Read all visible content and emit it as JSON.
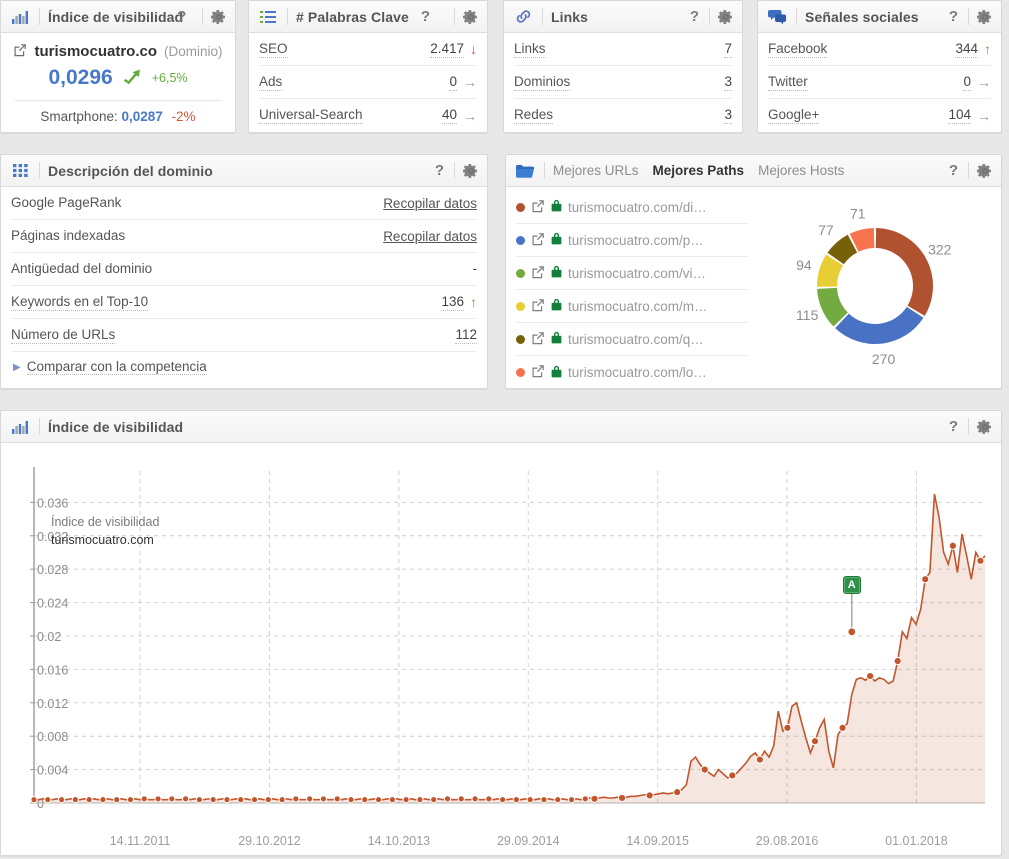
{
  "panels": {
    "visibility_index": {
      "title": "Índice de visibilidad",
      "icon": "bar-chart-icon",
      "help": "?",
      "domain": "turismocuatro.co",
      "domain_tag": "(Dominio)",
      "value": "0,0296",
      "delta": "+6,5%",
      "smartphone_label": "Smartphone:",
      "smartphone_value": "0,0287",
      "smartphone_delta": "-2%"
    },
    "keywords": {
      "title": "# Palabras Clave",
      "icon": "list-icon",
      "help": "?",
      "rows": [
        {
          "label": "SEO",
          "value": "2.417",
          "trend": "down"
        },
        {
          "label": "Ads",
          "value": "0",
          "trend": "right"
        },
        {
          "label": "Universal-Search",
          "value": "40",
          "trend": "right"
        }
      ]
    },
    "links": {
      "title": "Links",
      "icon": "link-icon",
      "help": "?",
      "rows": [
        {
          "label": "Links",
          "value": "7",
          "trend": "none"
        },
        {
          "label": "Dominios",
          "value": "3",
          "trend": "none"
        },
        {
          "label": "Redes",
          "value": "3",
          "trend": "none"
        }
      ]
    },
    "social": {
      "title": "Señales sociales",
      "icon": "speech-bubbles-icon",
      "help": "?",
      "rows": [
        {
          "label": "Facebook",
          "value": "344",
          "trend": "up"
        },
        {
          "label": "Twitter",
          "value": "0",
          "trend": "right"
        },
        {
          "label": "Google+",
          "value": "104",
          "trend": "right"
        }
      ]
    },
    "domain_description": {
      "title": "Descripción del dominio",
      "icon": "grid-icon",
      "help": "?",
      "rows": [
        {
          "label": "Google PageRank",
          "value": "Recopilar datos",
          "type": "link"
        },
        {
          "label": "Páginas indexadas",
          "value": "Recopilar datos",
          "type": "link"
        },
        {
          "label": "Antigüedad del dominio",
          "value": "-",
          "type": "plain"
        },
        {
          "label": "Keywords en el Top-10",
          "value": "136",
          "type": "value",
          "trend": "up"
        },
        {
          "label": "Número de URLs",
          "value": "112",
          "type": "value",
          "trend": "none"
        }
      ],
      "compare_label": "Comparar con la competencia"
    },
    "best_paths": {
      "icon": "folder-icon",
      "help": "?",
      "tabs": [
        {
          "label": "Mejores URLs",
          "active": false
        },
        {
          "label": "Mejores Paths",
          "active": true
        },
        {
          "label": "Mejores Hosts",
          "active": false
        }
      ],
      "items": [
        {
          "url": "turismocuatro.com/di…",
          "color": "#b0522f"
        },
        {
          "url": "turismocuatro.com/p…",
          "color": "#4a72c4"
        },
        {
          "url": "turismocuatro.com/vi…",
          "color": "#73ab41"
        },
        {
          "url": "turismocuatro.com/m…",
          "color": "#e8cd34"
        },
        {
          "url": "turismocuatro.com/q…",
          "color": "#786009"
        },
        {
          "url": "turismocuatro.com/lo…",
          "color": "#f7734f"
        }
      ]
    },
    "visibility_chart": {
      "title": "Índice de visibilidad",
      "icon": "bar-chart-icon",
      "help": "?",
      "series_title": "Índice de visibilidad",
      "series_domain": "turismocuatro.com",
      "annotation": "A"
    }
  },
  "chart_data": [
    {
      "type": "pie",
      "title": "Mejores Paths",
      "labels": [
        "turismocuatro.com/di…",
        "turismocuatro.com/p…",
        "turismocuatro.com/vi…",
        "turismocuatro.com/m…",
        "turismocuatro.com/q…",
        "turismocuatro.com/lo…"
      ],
      "values": [
        322,
        270,
        115,
        94,
        77,
        71
      ],
      "colors": [
        "#b0522f",
        "#4a72c4",
        "#73ab41",
        "#e8cd34",
        "#786009",
        "#f7734f"
      ],
      "donut": true,
      "legend": "left",
      "data_labels": [
        "322",
        "270",
        "115",
        "94",
        "77",
        "71"
      ]
    },
    {
      "type": "area",
      "title": "Índice de visibilidad",
      "series_name": "turismocuatro.com",
      "xlabel": "",
      "ylabel": "Índice de visibilidad",
      "ylim": [
        0,
        0.0376
      ],
      "yticks": [
        "0",
        "0.004",
        "0.008",
        "0.012",
        "0.016",
        "0.02",
        "0.024",
        "0.028",
        "0.032",
        "0.036"
      ],
      "ytick_values": [
        0,
        0.004,
        0.008,
        0.012,
        0.016,
        0.02,
        0.024,
        0.028,
        0.032,
        0.036
      ],
      "xticks": [
        "14.11.2011",
        "29.10.2012",
        "14.10.2013",
        "29.09.2014",
        "14.09.2015",
        "29.08.2016",
        "01.01.2018"
      ],
      "grid": true,
      "line_color": "#c2552c",
      "fill_color": "rgba(200,100,60,0.16)",
      "annotation_marker": {
        "label": "A",
        "x_index": 178,
        "y_value": 0.0205
      },
      "values": [
        0.0004,
        0.0004,
        0.0005,
        0.0004,
        0.0004,
        0.0005,
        0.0004,
        0.0004,
        0.0005,
        0.0004,
        0.0004,
        0.0005,
        0.0004,
        0.0005,
        0.0004,
        0.0004,
        0.0005,
        0.0004,
        0.0004,
        0.0005,
        0.0004,
        0.0004,
        0.0005,
        0.0004,
        0.0005,
        0.0004,
        0.0004,
        0.0005,
        0.0004,
        0.0004,
        0.0005,
        0.0004,
        0.0004,
        0.0005,
        0.0004,
        0.0005,
        0.0004,
        0.0004,
        0.0005,
        0.0004,
        0.0004,
        0.0005,
        0.0004,
        0.0004,
        0.0005,
        0.0004,
        0.0005,
        0.0004,
        0.0004,
        0.0005,
        0.0004,
        0.0004,
        0.0005,
        0.0004,
        0.0004,
        0.0005,
        0.0004,
        0.0005,
        0.0004,
        0.0004,
        0.0005,
        0.0004,
        0.0004,
        0.0005,
        0.0004,
        0.0004,
        0.0005,
        0.0004,
        0.0005,
        0.0004,
        0.0004,
        0.0005,
        0.0004,
        0.0004,
        0.0005,
        0.0004,
        0.0004,
        0.0005,
        0.0004,
        0.0005,
        0.0004,
        0.0004,
        0.0005,
        0.0004,
        0.0004,
        0.0005,
        0.0004,
        0.0004,
        0.0005,
        0.0004,
        0.0005,
        0.0004,
        0.0004,
        0.0005,
        0.0004,
        0.0004,
        0.0005,
        0.0004,
        0.0004,
        0.0005,
        0.0004,
        0.0005,
        0.0004,
        0.0004,
        0.0005,
        0.0004,
        0.0004,
        0.0005,
        0.0004,
        0.0004,
        0.0005,
        0.0004,
        0.0005,
        0.0004,
        0.0004,
        0.0005,
        0.0004,
        0.0004,
        0.0005,
        0.0004,
        0.0005,
        0.0006,
        0.0005,
        0.0006,
        0.0007,
        0.0006,
        0.0006,
        0.0007,
        0.0006,
        0.0007,
        0.0008,
        0.0008,
        0.0009,
        0.001,
        0.0009,
        0.001,
        0.0011,
        0.0012,
        0.0011,
        0.0012,
        0.0013,
        0.0016,
        0.0022,
        0.005,
        0.0055,
        0.0046,
        0.004,
        0.0036,
        0.0032,
        0.004,
        0.0035,
        0.003,
        0.0033,
        0.0036,
        0.0042,
        0.0048,
        0.0056,
        0.006,
        0.0052,
        0.0062,
        0.0055,
        0.0068,
        0.011,
        0.0086,
        0.009,
        0.0116,
        0.012,
        0.0098,
        0.0078,
        0.006,
        0.0074,
        0.009,
        0.01,
        0.0062,
        0.0042,
        0.0082,
        0.009,
        0.0095,
        0.013,
        0.0148,
        0.015,
        0.0147,
        0.0152,
        0.0146,
        0.015,
        0.0148,
        0.0143,
        0.0146,
        0.017,
        0.0205,
        0.0197,
        0.0222,
        0.0214,
        0.0232,
        0.0268,
        0.0276,
        0.037,
        0.0342,
        0.03,
        0.0286,
        0.0308,
        0.0276,
        0.0322,
        0.0296,
        0.0268,
        0.03,
        0.029,
        0.0296
      ]
    }
  ]
}
